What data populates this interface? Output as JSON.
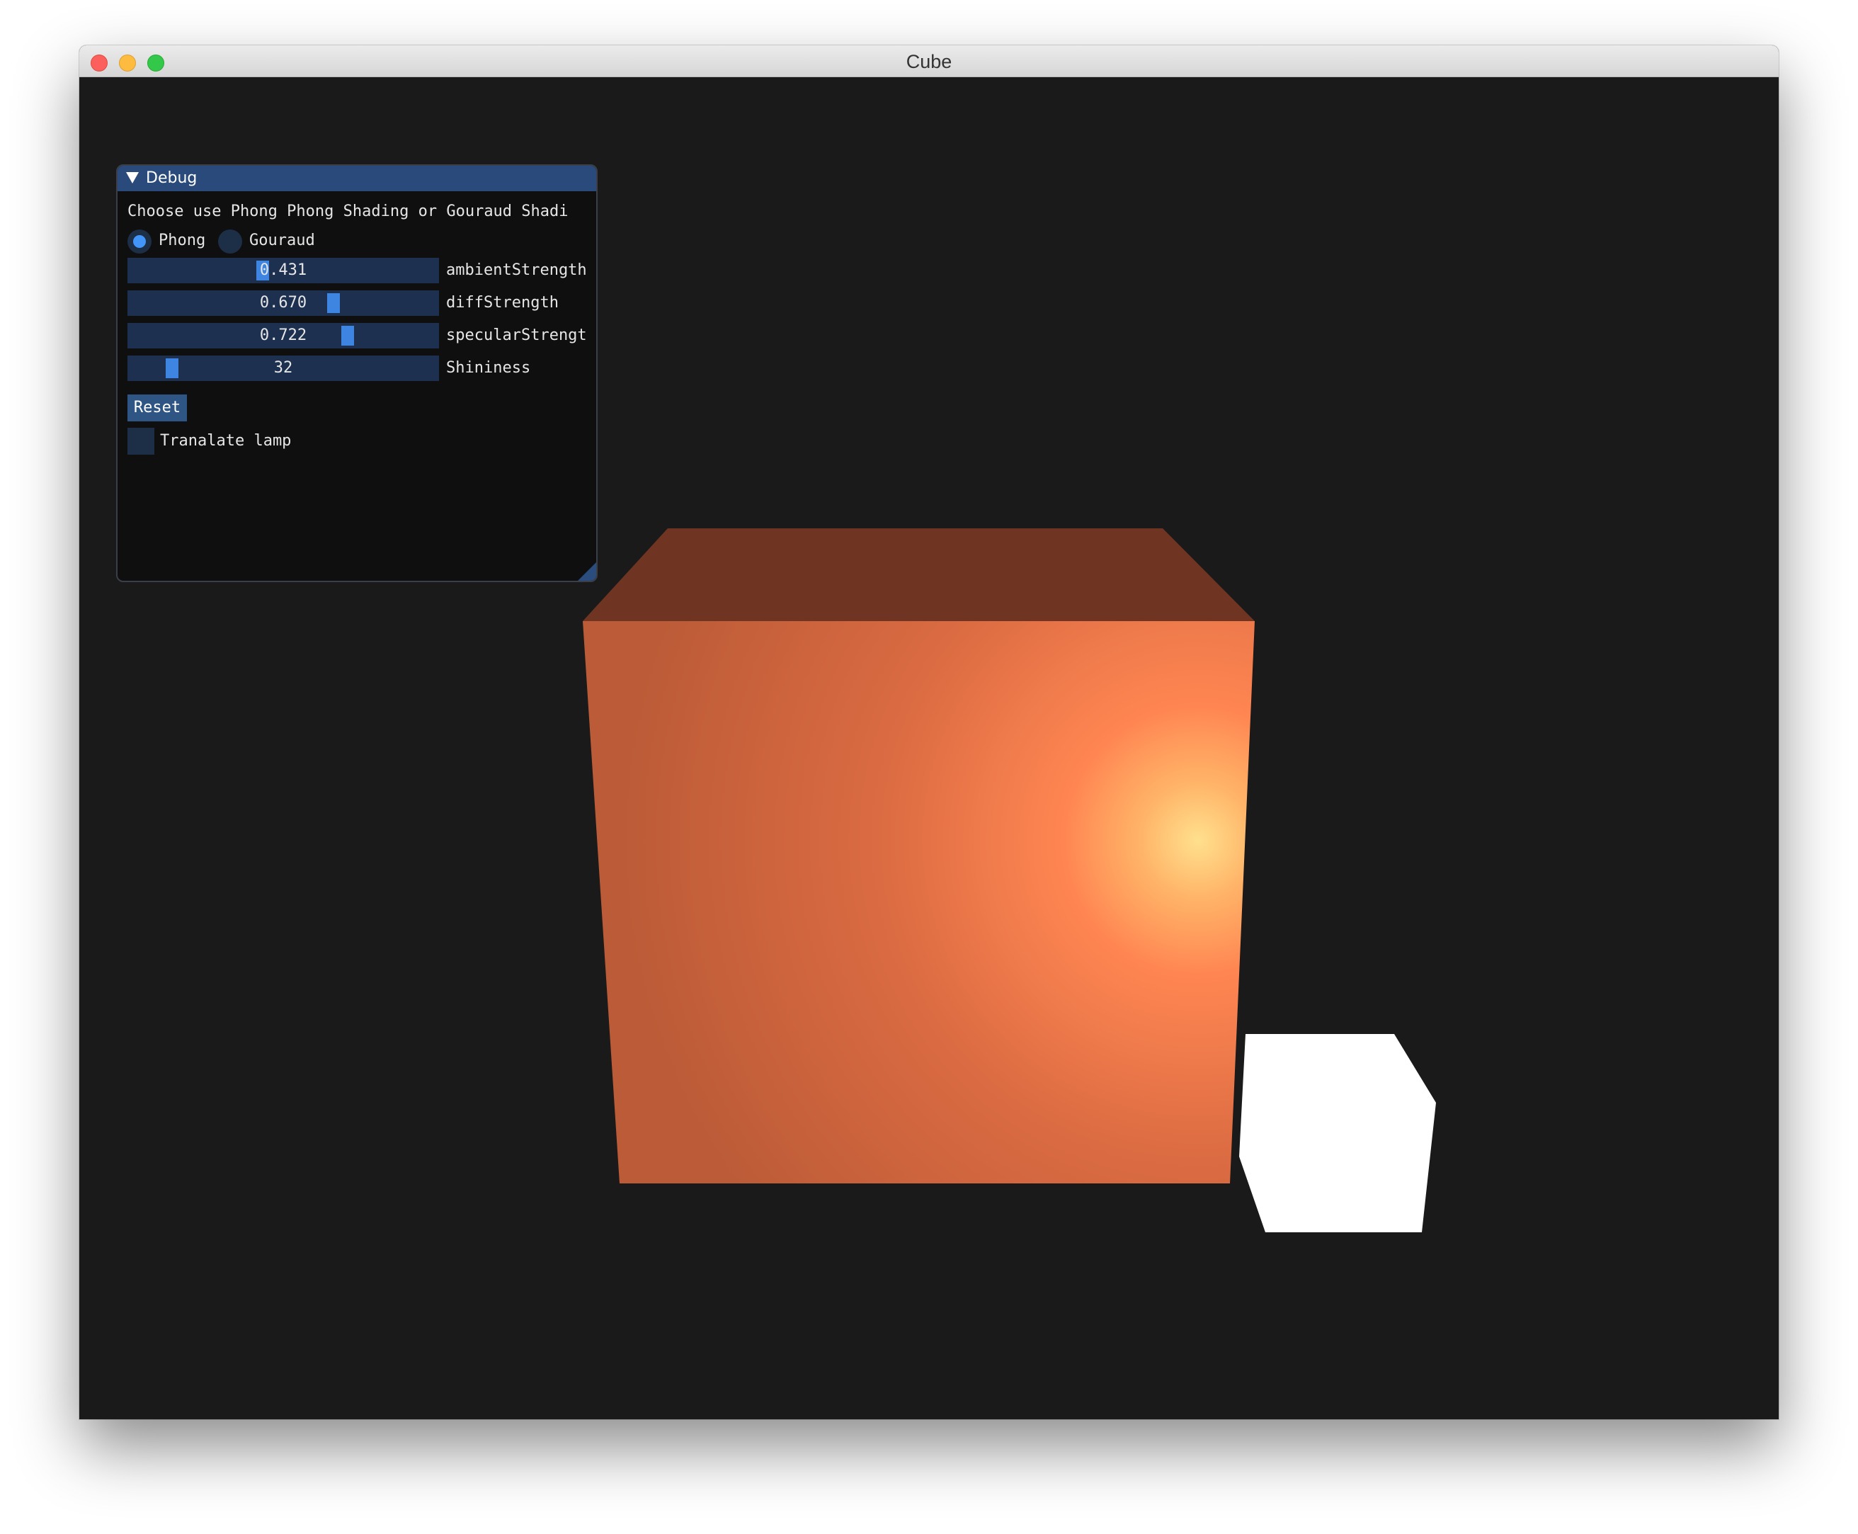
{
  "window": {
    "title": "Cube"
  },
  "debug": {
    "title": "Debug",
    "description": "Choose use Phong Phong Shading or Gouraud Shadi",
    "radios": [
      {
        "label": "Phong",
        "selected": true
      },
      {
        "label": "Gouraud",
        "selected": false
      }
    ],
    "sliders": [
      {
        "label": "ambientStrength",
        "value": "0.431",
        "fraction": 0.431
      },
      {
        "label": "diffStrength",
        "value": "0.670",
        "fraction": 0.67
      },
      {
        "label": "specularStrengt",
        "value": "0.722",
        "fraction": 0.722
      },
      {
        "label": "Shininess",
        "value": "32",
        "fraction": 0.11
      }
    ],
    "reset_label": "Reset",
    "translate_lamp": {
      "label": "Tranalate lamp",
      "checked": false
    }
  },
  "colors": {
    "background": "#1a1a1a",
    "cube_top": "#703522",
    "cube_front_base": "#c3603a",
    "specular": "#ffe38e",
    "lamp": "#ffffff",
    "accent": "#4296fa"
  }
}
